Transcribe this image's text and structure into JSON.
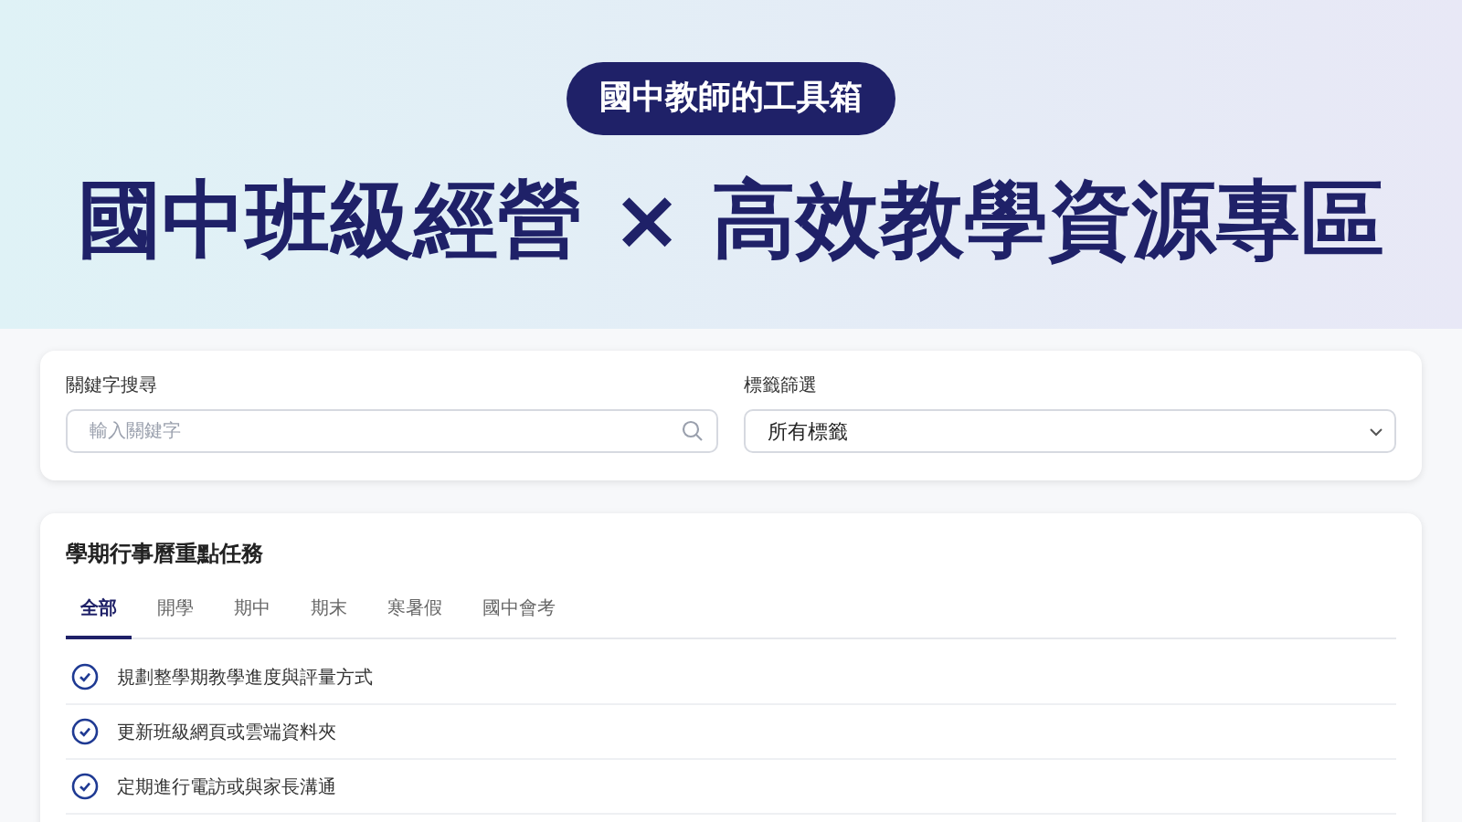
{
  "header": {
    "badge": "國中教師的工具箱",
    "title": "國中班級經營 × 高效教學資源專區"
  },
  "filters": {
    "keyword": {
      "label": "關鍵字搜尋",
      "placeholder": "輸入關鍵字"
    },
    "tag": {
      "label": "標籤篩選",
      "value": "所有標籤"
    }
  },
  "tasks": {
    "title": "學期行事曆重點任務",
    "tabs": [
      {
        "label": "全部",
        "selected": true
      },
      {
        "label": "開學",
        "selected": false
      },
      {
        "label": "期中",
        "selected": false
      },
      {
        "label": "期末",
        "selected": false
      },
      {
        "label": "寒暑假",
        "selected": false
      },
      {
        "label": "國中會考",
        "selected": false
      }
    ],
    "items": [
      "規劃整學期教學進度與評量方式",
      "更新班級網頁或雲端資料夾",
      "定期進行電訪或與家長溝通"
    ]
  }
}
